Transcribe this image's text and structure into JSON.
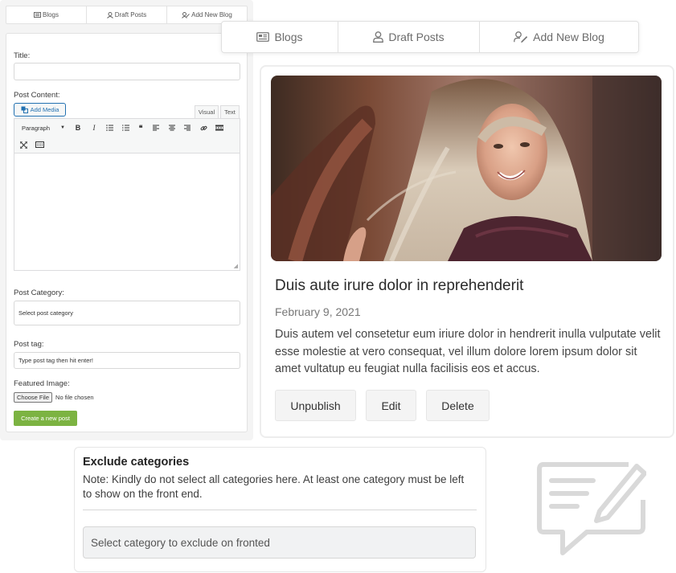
{
  "small_tabs": [
    {
      "label": "Blogs",
      "icon": "blog-icon"
    },
    {
      "label": "Draft Posts",
      "icon": "user-icon"
    },
    {
      "label": "Add New Blog",
      "icon": "user-edit-icon"
    }
  ],
  "form": {
    "title_label": "Title:",
    "content_label": "Post Content:",
    "add_media": "Add Media",
    "visual_tab": "Visual",
    "text_tab": "Text",
    "format_select": "Paragraph",
    "category_label": "Post Category:",
    "category_placeholder": "Select post category",
    "tag_label": "Post tag:",
    "tag_placeholder": "Type post tag then hit enter!",
    "image_label": "Featured Image:",
    "choose_file": "Choose File",
    "no_file": "No file chosen",
    "create_button": "Create a new post",
    "create_color": "#7cb342"
  },
  "big_tabs": [
    {
      "label": "Blogs",
      "icon": "blog-icon"
    },
    {
      "label": "Draft Posts",
      "icon": "user-icon"
    },
    {
      "label": "Add New Blog",
      "icon": "user-edit-icon"
    }
  ],
  "post": {
    "title": "Duis aute irure dolor in reprehenderit",
    "date": "February 9, 2021",
    "excerpt": "Duis autem vel consetetur eum iriure dolor in hendrerit inulla vulputate velit esse molestie at vero consequat, vel illum dolore lorem ipsum dolor sit amet vultatup eu feugiat nulla facilisis eos et accus.",
    "buttons": {
      "unpublish": "Unpublish",
      "edit": "Edit",
      "delete": "Delete"
    }
  },
  "exclude": {
    "title": "Exclude categories",
    "note": "Note: Kindly do not select all categories here. At least one category must be left to show on the front end.",
    "select_placeholder": "Select category to exclude on fronted"
  }
}
